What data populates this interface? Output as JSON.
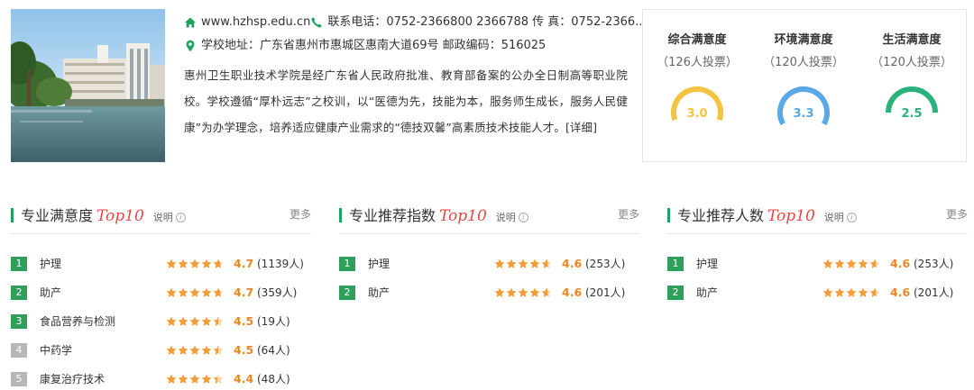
{
  "school": {
    "website": "www.hzhsp.edu.cn",
    "phone_label": "联系电话：0752-2366800 2366788 传 真：0752-2366...",
    "address_label": "学校地址：广东省惠州市惠城区惠南大道69号 邮政编码：516025",
    "description": "惠州卫生职业技术学院是经广东省人民政府批准、教育部备案的公办全日制高等职业院校。学校遵循“厚朴远志”之校训，以“医德为先，技能为本，服务师生成长，服务人民健康”为办学理念，培养适应健康产业需求的“德技双馨”高素质技术技能人才。",
    "detail_link": "[详细]"
  },
  "satisfaction": [
    {
      "title": "综合满意度",
      "votes": "（126人投票）",
      "value": "3.0",
      "score": 3.0,
      "color": "#f5c342"
    },
    {
      "title": "环境满意度",
      "votes": "（120人投票）",
      "value": "3.3",
      "score": 3.3,
      "color": "#5aa8e6"
    },
    {
      "title": "生活满意度",
      "votes": "（120人投票）",
      "value": "2.5",
      "score": 2.5,
      "color": "#2bb27a"
    }
  ],
  "columns": [
    {
      "title": "专业满意度",
      "top10": "Top10",
      "explain": "说明",
      "more": "更多",
      "rows": [
        {
          "rank": "1",
          "name": "护理",
          "rating": 4.7,
          "score": "4.7",
          "count": "(1139人)"
        },
        {
          "rank": "2",
          "name": "助产",
          "rating": 4.7,
          "score": "4.7",
          "count": "(359人)"
        },
        {
          "rank": "3",
          "name": "食品营养与检测",
          "rating": 4.5,
          "score": "4.5",
          "count": "(19人)"
        },
        {
          "rank": "4",
          "name": "中药学",
          "rating": 4.5,
          "score": "4.5",
          "count": "(64人)"
        },
        {
          "rank": "5",
          "name": "康复治疗技术",
          "rating": 4.4,
          "score": "4.4",
          "count": "(48人)"
        }
      ]
    },
    {
      "title": "专业推荐指数",
      "top10": "Top10",
      "explain": "说明",
      "more": "更多",
      "rows": [
        {
          "rank": "1",
          "name": "护理",
          "rating": 4.6,
          "score": "4.6",
          "count": "(253人)"
        },
        {
          "rank": "2",
          "name": "助产",
          "rating": 4.6,
          "score": "4.6",
          "count": "(201人)"
        }
      ]
    },
    {
      "title": "专业推荐人数",
      "top10": "Top10",
      "explain": "说明",
      "more": "更多",
      "rows": [
        {
          "rank": "1",
          "name": "护理",
          "rating": 4.6,
          "score": "4.6",
          "count": "(253人)"
        },
        {
          "rank": "2",
          "name": "助产",
          "rating": 4.6,
          "score": "4.6",
          "count": "(201人)"
        }
      ]
    }
  ],
  "colors": {
    "accent_green": "#1ea25e",
    "top10_red": "#e9463e",
    "star_orange": "#f29b38",
    "score_orange": "#e98822",
    "rank_gray": "#b7b7b7"
  },
  "icons": {
    "website": "home-icon",
    "phone": "phone-icon",
    "address": "location-pin-icon",
    "explain": "info-circle-icon",
    "rating": "star-icon"
  }
}
